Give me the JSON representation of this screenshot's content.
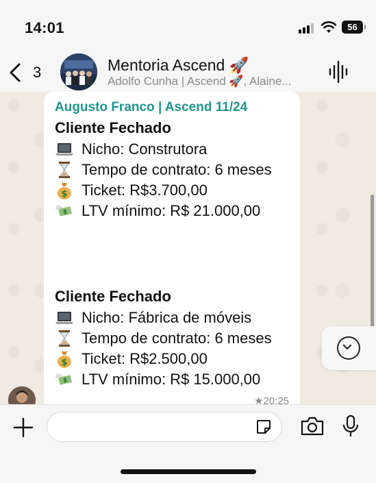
{
  "status_bar": {
    "time": "14:01",
    "battery": "56"
  },
  "header": {
    "back_count": "3",
    "title": "Mentoria Ascend 🚀",
    "subtitle": "Adolfo Cunha | Ascend 🚀, Alaine..."
  },
  "message": {
    "sender": "Augusto Franco | Ascend 11/24",
    "blocks": [
      {
        "heading": "Cliente Fechado",
        "niche": "Nicho: Construtora",
        "contract": "Tempo de contrato: 6 meses",
        "ticket": "Ticket: R$3.700,00",
        "ltv": "LTV mínimo: R$ 21.000,00"
      },
      {
        "heading": "Cliente Fechado",
        "niche": "Nicho: Fábrica de móveis",
        "contract": "Tempo de contrato: 6 meses",
        "ticket": "Ticket: R$2.500,00",
        "ltv": "LTV mínimo: R$ 15.000,00"
      }
    ],
    "timestamp": "★20:25"
  },
  "icons": {
    "laptop": "laptop-icon",
    "hourglass": "hourglass-icon",
    "money_bag": "money-bag-icon",
    "money_wings": "money-with-wings-icon"
  },
  "colors": {
    "sender": "#21948a",
    "bubble": "#ffffff",
    "chat_bg": "#efeae2"
  }
}
